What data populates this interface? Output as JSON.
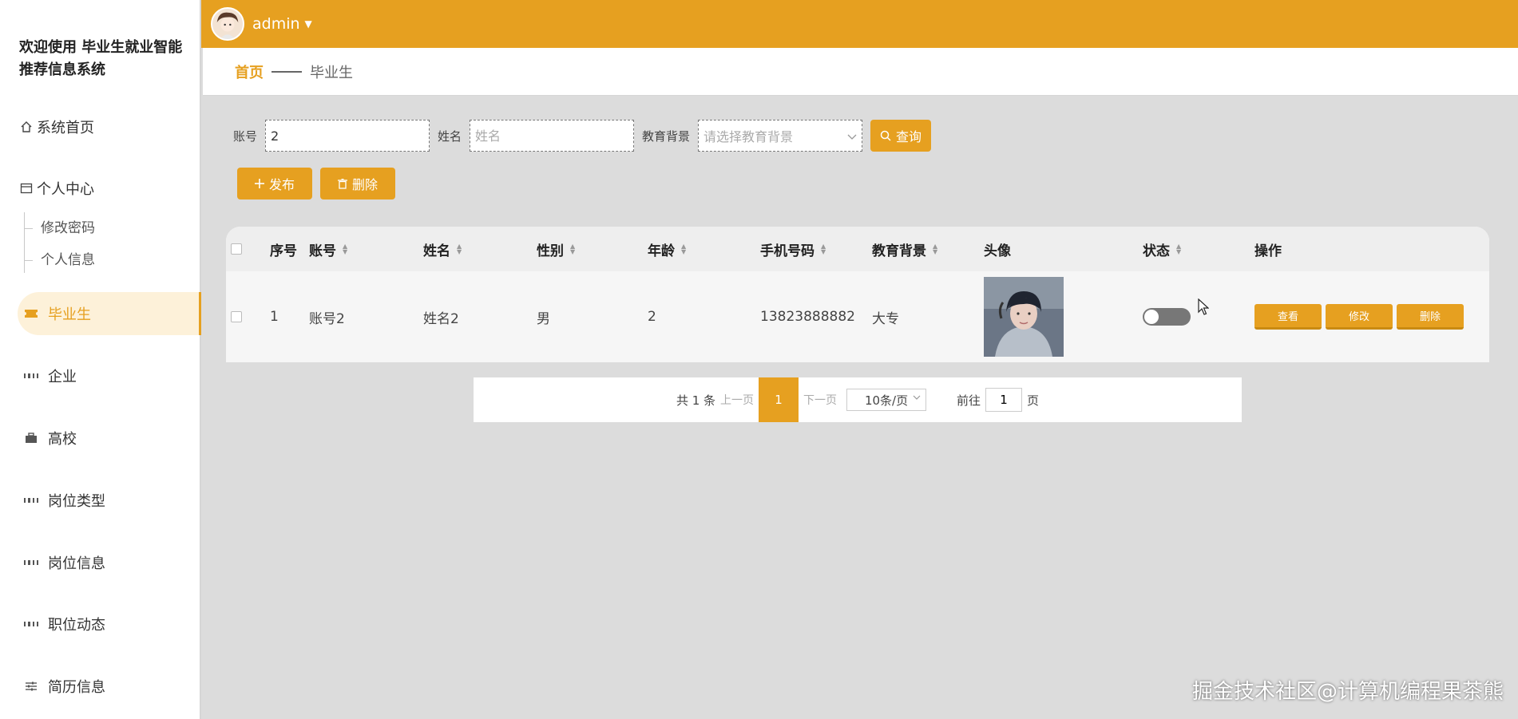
{
  "sidebar": {
    "title": "欢迎使用 毕业生就业智能推荐信息系统",
    "items": [
      {
        "label": "系统首页",
        "icon": "home-icon"
      },
      {
        "label": "个人中心",
        "icon": "window-icon"
      },
      {
        "label": "毕业生",
        "icon": "ticket-icon"
      },
      {
        "label": "企业",
        "icon": "grid-icon"
      },
      {
        "label": "高校",
        "icon": "briefcase-icon"
      },
      {
        "label": "岗位类型",
        "icon": "grid-icon"
      },
      {
        "label": "岗位信息",
        "icon": "grid-icon"
      },
      {
        "label": "职位动态",
        "icon": "grid-icon"
      },
      {
        "label": "简历信息",
        "icon": "sliders-icon"
      }
    ],
    "sub_items": [
      {
        "label": "修改密码"
      },
      {
        "label": "个人信息"
      }
    ]
  },
  "header": {
    "user": "admin",
    "accent": "#e6a020"
  },
  "breadcrumb": {
    "home": "首页",
    "current": "毕业生"
  },
  "search": {
    "account_label": "账号",
    "account_value": "2",
    "name_label": "姓名",
    "name_placeholder": "姓名",
    "edu_label": "教育背景",
    "edu_placeholder": "请选择教育背景",
    "query_button": "查询"
  },
  "actions": {
    "publish": "发布",
    "delete": "删除"
  },
  "table": {
    "headers": [
      "序号",
      "账号",
      "姓名",
      "性别",
      "年龄",
      "手机号码",
      "教育背景",
      "头像",
      "状态",
      "操作"
    ],
    "rows": [
      {
        "index": "1",
        "account": "账号2",
        "name": "姓名2",
        "gender": "男",
        "age": "2",
        "phone": "13823888882",
        "education": "大专",
        "status_on": false
      }
    ],
    "row_buttons": {
      "view": "查看",
      "edit": "修改",
      "delete": "删除"
    }
  },
  "pagination": {
    "total": "共 1 条",
    "prev": "上一页",
    "page": "1",
    "next": "下一页",
    "page_size": "10条/页",
    "goto_label": "前往",
    "goto_value": "1",
    "page_unit": "页"
  },
  "watermark": "掘金技术社区@计算机编程果茶熊"
}
